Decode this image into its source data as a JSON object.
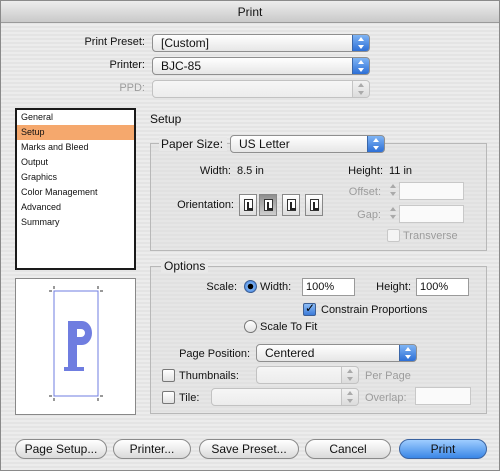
{
  "window": {
    "title": "Print"
  },
  "header": {
    "print_preset_label": "Print Preset:",
    "print_preset_value": "[Custom]",
    "printer_label": "Printer:",
    "printer_value": "BJC-85",
    "ppd_label": "PPD:",
    "ppd_value": ""
  },
  "sidebar": {
    "items": [
      {
        "label": "General"
      },
      {
        "label": "Setup"
      },
      {
        "label": "Marks and Bleed"
      },
      {
        "label": "Output"
      },
      {
        "label": "Graphics"
      },
      {
        "label": "Color Management"
      },
      {
        "label": "Advanced"
      },
      {
        "label": "Summary"
      }
    ],
    "selected": "Setup"
  },
  "setup": {
    "heading": "Setup",
    "paper_size_label": "Paper Size:",
    "paper_size_value": "US Letter",
    "width_label": "Width:",
    "width_value": "8.5 in",
    "height_label": "Height:",
    "height_value": "11 in",
    "orientation_label": "Orientation:",
    "offset_label": "Offset:",
    "offset_value": "",
    "gap_label": "Gap:",
    "gap_value": "",
    "transverse_label": "Transverse"
  },
  "options": {
    "heading": "Options",
    "scale_label": "Scale:",
    "scale_width_label": "Width:",
    "scale_width_value": "100%",
    "scale_height_label": "Height:",
    "scale_height_value": "100%",
    "constrain_label": "Constrain Proportions",
    "constrain_checked": true,
    "scale_to_fit_label": "Scale To Fit",
    "page_position_label": "Page Position:",
    "page_position_value": "Centered",
    "thumbnails_label": "Thumbnails:",
    "thumbnails_value": "",
    "per_page_label": "Per Page",
    "tile_label": "Tile:",
    "tile_value": "",
    "overlap_label": "Overlap:",
    "overlap_value": ""
  },
  "footer": {
    "page_setup_label": "Page Setup...",
    "printer_label": "Printer...",
    "save_preset_label": "Save Preset...",
    "cancel_label": "Cancel",
    "print_label": "Print"
  },
  "colors": {
    "selection": "#f5a86d",
    "accent_blue": "#2d6fd6",
    "preview_letter": "#6f7de0"
  },
  "icons": {
    "orientation": [
      "portrait-icon",
      "landscape-icon",
      "reverse-portrait-icon",
      "reverse-landscape-icon"
    ]
  }
}
